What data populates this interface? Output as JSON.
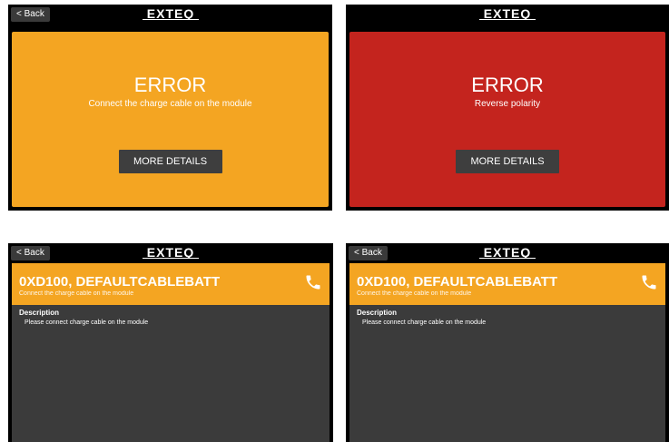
{
  "colors": {
    "orange": "#F4A522",
    "red": "#C4241E",
    "panel_dark": "#3B3B3B",
    "button_dark": "#3E3E3E"
  },
  "screens": [
    {
      "back_label": "< Back",
      "logo_text": "EXTEQ",
      "title": "ERROR",
      "message": "Connect the charge cable on the module",
      "button_label": "MORE DETAILS"
    },
    {
      "logo_text": "EXTEQ",
      "title": "ERROR",
      "message": "Reverse polarity",
      "button_label": "MORE DETAILS"
    },
    {
      "back_label": "< Back",
      "logo_text": "EXTEQ",
      "code": "0XD100, DEFAULTCABLEBATT",
      "subtitle": "Connect the charge cable on the module",
      "desc_title": "Description",
      "desc_text": "Please connect charge cable on the module",
      "icon": "phone-icon"
    },
    {
      "back_label": "< Back",
      "logo_text": "EXTEQ",
      "code": "0XD100, DEFAULTCABLEBATT",
      "subtitle": "Connect the charge cable on the module",
      "desc_title": "Description",
      "desc_text": "Please connect charge cable on the module",
      "icon": "phone-icon"
    }
  ]
}
